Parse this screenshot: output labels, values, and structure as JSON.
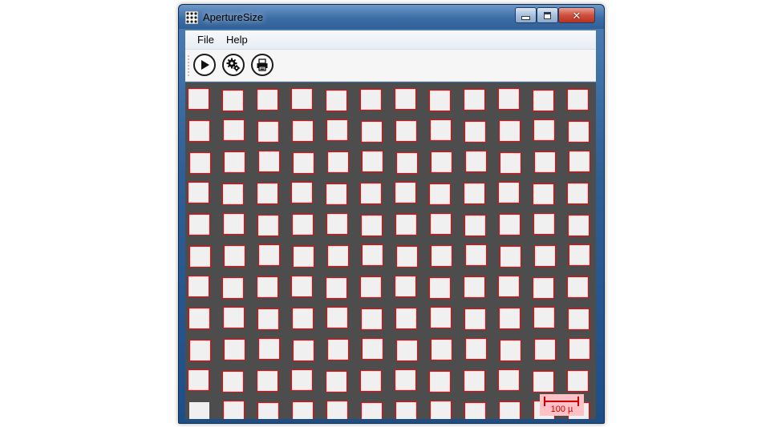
{
  "window": {
    "title": "ApertureSize"
  },
  "menu": [
    {
      "label": "File"
    },
    {
      "label": "Help"
    }
  ],
  "toolbar": {
    "buttons": [
      {
        "icon": "play-icon"
      },
      {
        "icon": "gears-icon"
      },
      {
        "icon": "printer-icon"
      }
    ]
  },
  "image": {
    "grid_columns": 12,
    "grid_rows": 11,
    "aperture_fill": "#f0f0f0",
    "detection_outline": "#dd1111",
    "mesh_color": "#4d4d4d",
    "scale_bar": {
      "label": "100 µ",
      "color": "#cc0000",
      "background": "#ffc0c6"
    }
  }
}
